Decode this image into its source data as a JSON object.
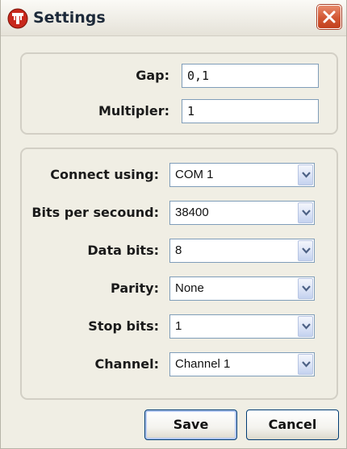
{
  "window": {
    "title": "Settings",
    "close_icon": "close-icon"
  },
  "general": {
    "gap": {
      "label": "Gap:",
      "value": "0,1"
    },
    "multiplier": {
      "label": "Multipler:",
      "value": "1"
    }
  },
  "connection": {
    "connect_using": {
      "label": "Connect using:",
      "value": "COM 1"
    },
    "bits_per_second": {
      "label": "Bits per secound:",
      "value": "38400"
    },
    "data_bits": {
      "label": "Data bits:",
      "value": "8"
    },
    "parity": {
      "label": "Parity:",
      "value": "None"
    },
    "stop_bits": {
      "label": "Stop bits:",
      "value": "1"
    },
    "channel": {
      "label": "Channel:",
      "value": "Channel 1"
    }
  },
  "buttons": {
    "save_label": "Save",
    "cancel_label": "Cancel"
  },
  "colors": {
    "window_bg": "#f0eee4",
    "close_button": "#d25733",
    "field_border": "#7f9db9",
    "button_border": "#003c74"
  }
}
